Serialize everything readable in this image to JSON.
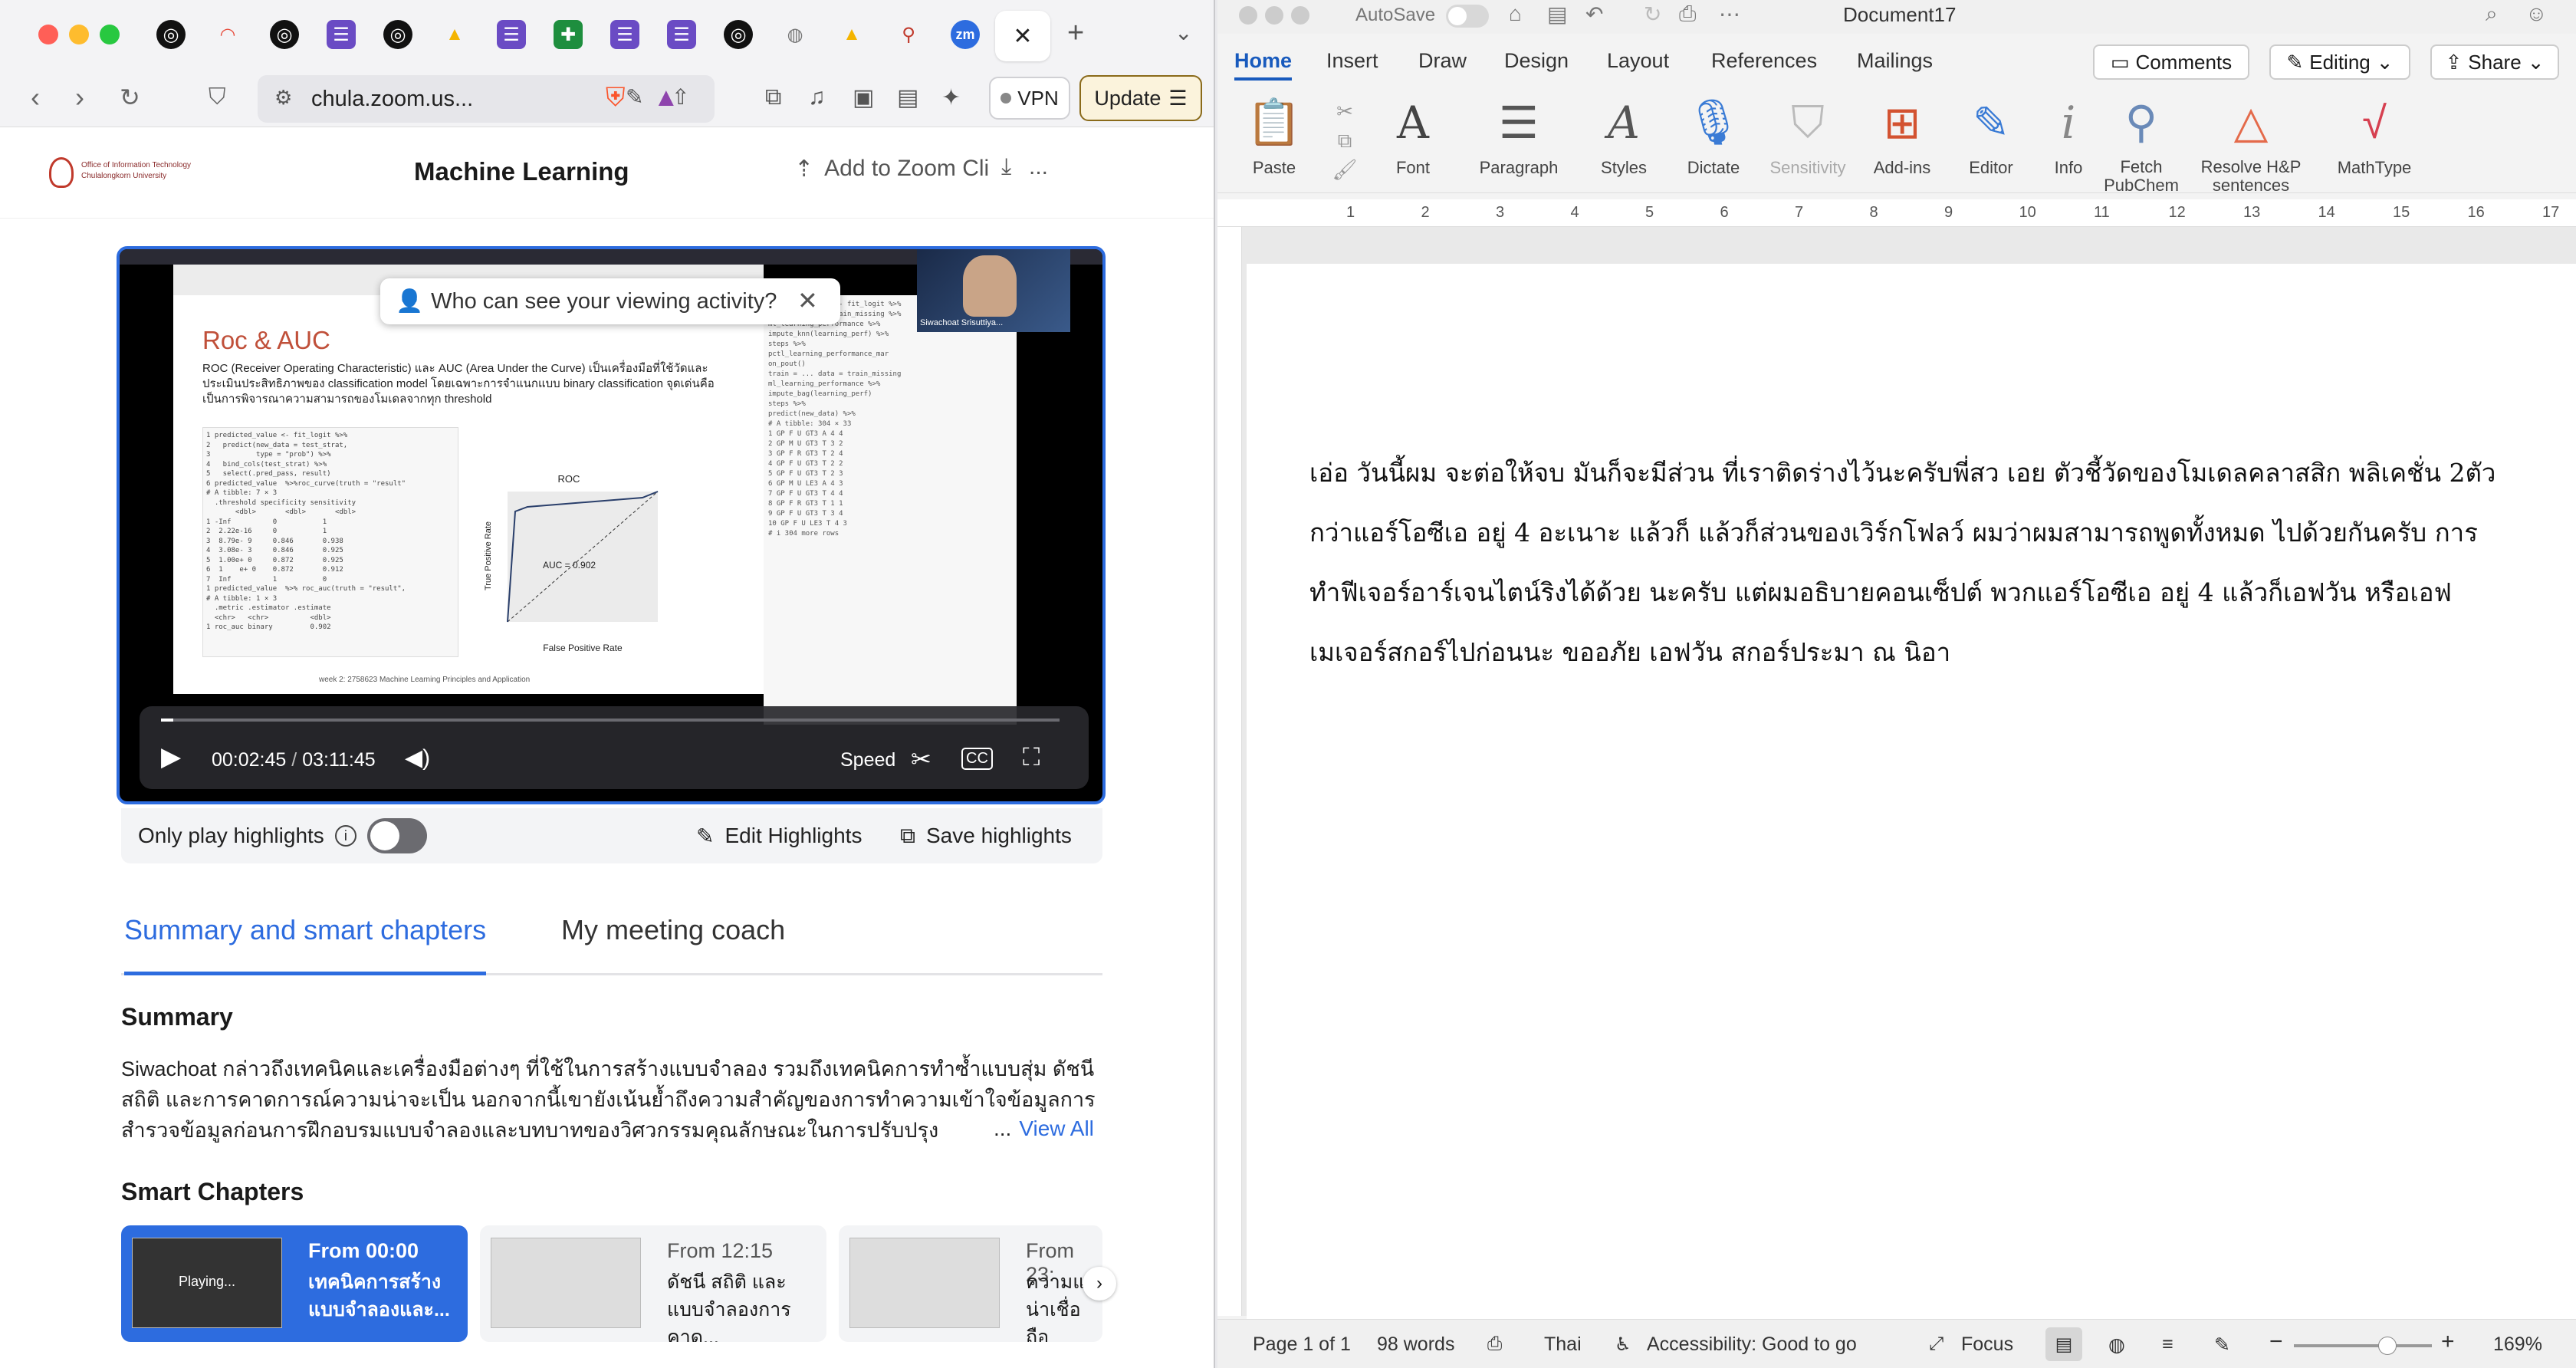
{
  "browser": {
    "tabs": [
      "",
      "",
      "",
      "",
      "",
      "",
      "",
      "",
      "",
      "",
      "",
      "",
      "",
      "",
      "",
      "",
      "",
      "",
      "",
      ""
    ],
    "active_tab_close": "✕",
    "new_tab": "+",
    "url": "chula.zoom.us...",
    "vpn_label": "VPN",
    "update_label": "Update"
  },
  "zoom": {
    "org_name": "Office of Information Technology",
    "org_sub": "Chulalongkorn University",
    "meeting_title": "Machine Learning",
    "add_to_zoom": "Add to Zoom Cli",
    "more": "..."
  },
  "player": {
    "popup_text": "Who can see your viewing activity?",
    "time_current": "00:02:45",
    "time_sep": "/",
    "time_total": "03:11:45",
    "speed_label": "Speed",
    "progress": 0.014,
    "speaker_name": "Siwachoat Srisuttiya...",
    "slide": {
      "title": "Roc & AUC",
      "body": "ROC (Receiver Operating Characteristic) และ AUC (Area Under the Curve) เป็นเครื่องมือที่ใช้วัดและประเมินประสิทธิภาพของ classification model โดยเฉพาะการจำแนกแบบ binary classification จุดเด่นคือเป็นการพิจารณาความสามารถของโมเดลจากทุก threshold",
      "roc_title": "ROC",
      "auc_label": "AUC = 0.902",
      "xlabel": "False Positive Rate",
      "ylabel": "True Positive Rate",
      "footer": "week 2: 2758623 Machine Learning Principles and Application"
    }
  },
  "highlights": {
    "only_play": "Only play highlights",
    "edit": "Edit Highlights",
    "save": "Save highlights"
  },
  "panel_tabs": {
    "summary": "Summary and smart chapters",
    "coach": "My meeting coach"
  },
  "summary": {
    "heading": "Summary",
    "text": "Siwachoat กล่าวถึงเทคนิคและเครื่องมือต่างๆ ที่ใช้ในการสร้างแบบจำลอง รวมถึงเทคนิคการทำซ้ำแบบสุ่ม ดัชนีสถิติ และการคาดการณ์ความน่าจะเป็น นอกจากนี้เขายังเน้นย้ำถึงความสำคัญของการทำความเข้าใจข้อมูลการสำรวจข้อมูลก่อนการฝึกอบรมแบบจำลองและบทบาทของวิศวกรรมคุณลักษณะในการปรับปรุง",
    "ellipsis": "...",
    "view_all": "View All"
  },
  "smart_chapters": {
    "heading": "Smart Chapters",
    "items": [
      {
        "from": "From 00:00",
        "title": "เทคนิคการสร้างแบบจำลองและ...",
        "playing": "Playing..."
      },
      {
        "from": "From 12:15",
        "title": "ดัชนี สถิติ และแบบจำลองการคาด..."
      },
      {
        "from": "From 23:",
        "title": "ความแม น่าเชื่อถือ"
      }
    ]
  },
  "word": {
    "autosave": "AutoSave",
    "doc_title": "Document17",
    "ribbon_tabs": [
      "Home",
      "Insert",
      "Draw",
      "Design",
      "Layout",
      "References",
      "Mailings"
    ],
    "comments": "Comments",
    "editing": "Editing",
    "share": "Share",
    "groups": [
      "Paste",
      "Font",
      "Paragraph",
      "Styles",
      "Dictate",
      "Sensitivity",
      "Add-ins",
      "Editor",
      "Info",
      "Fetch PubChem",
      "Resolve H&P sentences",
      "MathType"
    ],
    "ruler_numbers": [
      "1",
      "2",
      "3",
      "4",
      "5",
      "6",
      "7",
      "8",
      "9",
      "10",
      "11",
      "12",
      "13",
      "14",
      "15",
      "16",
      "17"
    ],
    "document_text": "เอ่อ วันนี้ผม จะต่อให้จบ มันก็จะมีส่วน ที่เราติดร่างไว้นะครับพี่สว เอย ตัวชี้วัดของโมเดลคลาสสิก พลิเคชั่น 2ตัวกว่าแอร์โอซีเอ อยู่ 4 อะเนาะ แล้วก็ แล้วก็ส่วนของเวิร์กโฟลว์ ผมว่าผมสามารถพูดทั้งหมด ไปด้วยกันครับ การทำฟีเจอร์อาร์เจนไตน์ริงได้ด้วย นะครับ แต่ผมอธิบายคอนเซ็ปต์ พวกแอร์โอซีเอ อยู่ 4 แล้วก็เอฟวัน หรือเอฟ เมเจอร์สกอร์ไปก่อนนะ ขออภัย เอฟวัน สกอร์ประมา ณ นิอา",
    "status": {
      "page": "Page 1 of 1",
      "words": "98 words",
      "language": "Thai",
      "accessibility": "Accessibility: Good to go",
      "focus": "Focus",
      "zoom": "169%"
    }
  },
  "colors": {
    "accent": "#2d6cdf",
    "word_accent": "#185abd"
  }
}
